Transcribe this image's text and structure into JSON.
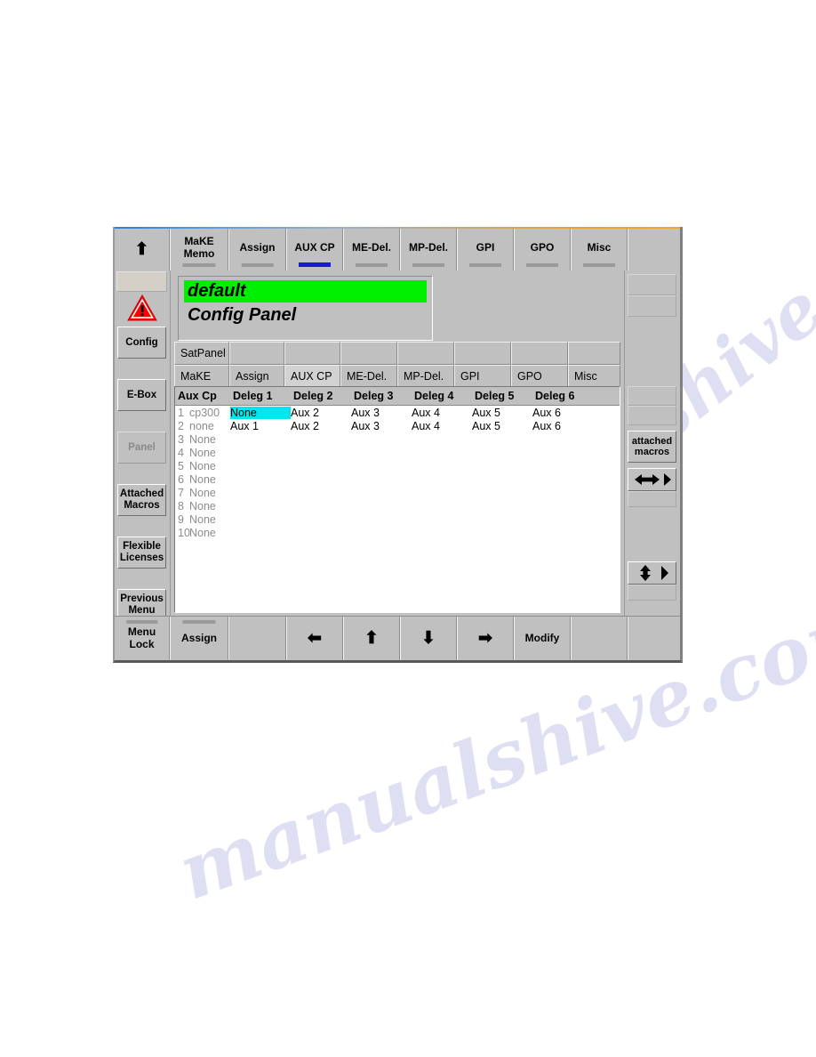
{
  "watermark": {
    "line1": "manualshive.c",
    "line2": "manualshive.com"
  },
  "top_bar": {
    "up_arrow_icon": "arrow-up-icon",
    "tabs": [
      {
        "label": "MaKE\nMemo",
        "active": false,
        "underline": true
      },
      {
        "label": "Assign",
        "active": false,
        "underline": true
      },
      {
        "label": "AUX CP",
        "active": true,
        "underline": true
      },
      {
        "label": "ME-Del.",
        "active": false,
        "underline": true
      },
      {
        "label": "MP-Del.",
        "active": false,
        "underline": true
      },
      {
        "label": "GPI",
        "active": false,
        "underline": true
      },
      {
        "label": "GPO",
        "active": false,
        "underline": true
      },
      {
        "label": "Misc",
        "active": false,
        "underline": true
      },
      {
        "label": "",
        "active": false,
        "underline": false
      }
    ]
  },
  "left_sidebar": {
    "warning_icon": "warning-triangle-icon",
    "buttons": [
      {
        "label": "Config",
        "disabled": false
      },
      {
        "label": "E-Box",
        "disabled": false
      },
      {
        "label": "Panel",
        "disabled": true
      },
      {
        "label": "Attached\nMacros",
        "disabled": false
      },
      {
        "label": "Flexible\nLicenses",
        "disabled": false
      },
      {
        "label": "Previous\nMenu",
        "disabled": false
      }
    ]
  },
  "right_sidebar": {
    "buttons": [
      {
        "label": "",
        "kind": "blank"
      },
      {
        "label": "",
        "kind": "blank"
      },
      {
        "label": "attached\nmacros",
        "kind": "text"
      },
      {
        "label": "",
        "kind": "h-arrow"
      },
      {
        "label": "",
        "kind": "v-arrow"
      }
    ],
    "h_arrow_icon": "arrows-left-right-icon",
    "v_arrow_icon": "arrows-up-down-icon",
    "triangle_icon": "triangle-right-icon"
  },
  "title_box": {
    "name": "default",
    "subtitle": "Config Panel"
  },
  "inner_tabs": {
    "row1": [
      "SatPanel",
      "",
      "",
      "",
      "",
      "",
      "",
      ""
    ],
    "row2": [
      {
        "label": "MaKE",
        "selected": false
      },
      {
        "label": "Assign",
        "selected": false
      },
      {
        "label": "AUX CP",
        "selected": true
      },
      {
        "label": "ME-Del.",
        "selected": false
      },
      {
        "label": "MP-Del.",
        "selected": false
      },
      {
        "label": "GPI",
        "selected": false
      },
      {
        "label": "GPO",
        "selected": false
      },
      {
        "label": "Misc",
        "selected": false
      }
    ]
  },
  "table": {
    "headers": [
      "Aux Cp",
      "Deleg 1",
      "Deleg 2",
      "Deleg 3",
      "Deleg 4",
      "Deleg 5",
      "Deleg 6"
    ],
    "rows": [
      {
        "num": "1",
        "name": "cp300",
        "cells": [
          "None",
          "Aux 2",
          "Aux 3",
          "Aux 4",
          "Aux 5",
          "Aux 6"
        ],
        "highlight": 0
      },
      {
        "num": "2",
        "name": "none",
        "cells": [
          "Aux 1",
          "Aux 2",
          "Aux 3",
          "Aux 4",
          "Aux 5",
          "Aux 6"
        ],
        "highlight": -1
      },
      {
        "num": "3",
        "name": "None",
        "cells": [
          "",
          "",
          "",
          "",
          "",
          ""
        ],
        "highlight": -1
      },
      {
        "num": "4",
        "name": "None",
        "cells": [
          "",
          "",
          "",
          "",
          "",
          ""
        ],
        "highlight": -1
      },
      {
        "num": "5",
        "name": "None",
        "cells": [
          "",
          "",
          "",
          "",
          "",
          ""
        ],
        "highlight": -1
      },
      {
        "num": "6",
        "name": "None",
        "cells": [
          "",
          "",
          "",
          "",
          "",
          ""
        ],
        "highlight": -1
      },
      {
        "num": "7",
        "name": "None",
        "cells": [
          "",
          "",
          "",
          "",
          "",
          ""
        ],
        "highlight": -1
      },
      {
        "num": "8",
        "name": "None",
        "cells": [
          "",
          "",
          "",
          "",
          "",
          ""
        ],
        "highlight": -1
      },
      {
        "num": "9",
        "name": "None",
        "cells": [
          "",
          "",
          "",
          "",
          "",
          ""
        ],
        "highlight": -1
      },
      {
        "num": "10",
        "name": "None",
        "cells": [
          "",
          "",
          "",
          "",
          "",
          ""
        ],
        "highlight": -1
      }
    ]
  },
  "bottom_bar": {
    "menu_lock_label": "Menu\nLock",
    "buttons": [
      {
        "label": "Assign",
        "icon": "",
        "underline": true
      },
      {
        "label": "",
        "icon": "",
        "underline": false
      },
      {
        "label": "",
        "icon": "arrow-left-icon",
        "underline": false
      },
      {
        "label": "",
        "icon": "arrow-up-icon",
        "underline": false
      },
      {
        "label": "",
        "icon": "arrow-down-icon",
        "underline": false
      },
      {
        "label": "",
        "icon": "arrow-right-icon",
        "underline": false
      },
      {
        "label": "Modify",
        "icon": "",
        "underline": false
      },
      {
        "label": "",
        "icon": "",
        "underline": false
      },
      {
        "label": "",
        "icon": "",
        "underline": false
      }
    ]
  },
  "colors": {
    "panel": "#c0c0c0",
    "highlight": "#00e5ee",
    "name_green": "#00ee00",
    "active_tab_underline": "#1a1ad0",
    "inactive_underline": "#9a9a9a"
  }
}
